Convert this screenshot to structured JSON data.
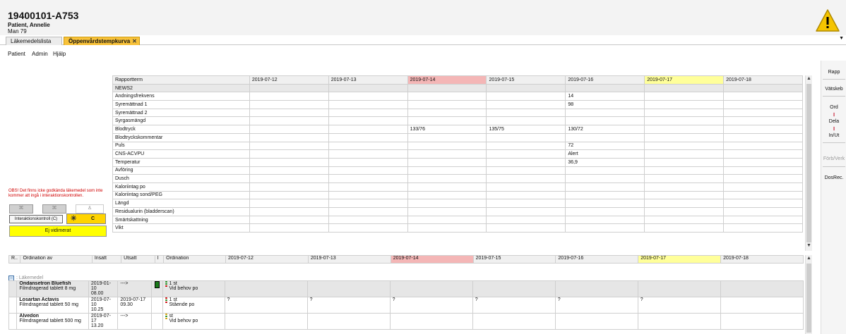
{
  "patient": {
    "id": "19400101-A753",
    "name": "Patient, Annelie",
    "gender_age": "Man 79"
  },
  "tabs": [
    {
      "label": "Läkemedelslista"
    },
    {
      "label": "Öppenvårdstempkurva"
    }
  ],
  "menu": [
    "Patient",
    "Admin",
    "Hjälp"
  ],
  "sidebar": [
    "Rapp",
    "Vätskeb",
    "Ord",
    "Dela",
    "In/Ut",
    "Förb/Verk",
    "DosRec."
  ],
  "left_panel": {
    "warning": "OBS! Det finns icke godkända läkemedel som inte kommer att ingå i interaktionskontrollen.",
    "interaction_button": "Interaktionskontroll (C)",
    "c_button": "C",
    "ejvid": "Ej vidimerat"
  },
  "vitals": {
    "header_term": "Rapportterm",
    "dates": [
      "2019-07-12",
      "2019-07-13",
      "2019-07-14",
      "2019-07-15",
      "2019-07-16",
      "2019-07-17",
      "2019-07-18"
    ],
    "highlight": {
      "2019-07-14": "#f4b6b6",
      "2019-07-17": "#ffff9a"
    },
    "rows": [
      {
        "term": "NEWS2",
        "values": [
          "",
          "",
          "",
          "",
          "",
          "",
          ""
        ]
      },
      {
        "term": "Andningsfrekvens",
        "values": [
          "",
          "",
          "",
          "",
          "14",
          "",
          ""
        ]
      },
      {
        "term": "Syremättnad 1",
        "values": [
          "",
          "",
          "",
          "",
          "98",
          "",
          ""
        ]
      },
      {
        "term": "Syremättnad 2",
        "values": [
          "",
          "",
          "",
          "",
          "",
          "",
          ""
        ]
      },
      {
        "term": "Syrgasmängd",
        "values": [
          "",
          "",
          "",
          "",
          "",
          "",
          ""
        ]
      },
      {
        "term": "Blodtryck",
        "values": [
          "",
          "",
          "133/76",
          "135/75",
          "130/72",
          "",
          ""
        ]
      },
      {
        "term": "Blodtryckskommentar",
        "values": [
          "",
          "",
          "",
          "",
          "",
          "",
          ""
        ]
      },
      {
        "term": "Puls",
        "values": [
          "",
          "",
          "",
          "",
          "72",
          "",
          ""
        ]
      },
      {
        "term": "CNS-ACVPU",
        "values": [
          "",
          "",
          "",
          "",
          "Alert",
          "",
          ""
        ]
      },
      {
        "term": "Temperatur",
        "values": [
          "",
          "",
          "",
          "",
          "36,9",
          "",
          ""
        ]
      },
      {
        "term": "Avföring",
        "values": [
          "",
          "",
          "",
          "",
          "",
          "",
          ""
        ]
      },
      {
        "term": "Dusch",
        "values": [
          "",
          "",
          "",
          "",
          "",
          "",
          ""
        ]
      },
      {
        "term": "Kaloriintag po",
        "values": [
          "",
          "",
          "",
          "",
          "",
          "",
          ""
        ]
      },
      {
        "term": "Kaloriintag sond/PEG",
        "values": [
          "",
          "",
          "",
          "",
          "",
          "",
          ""
        ]
      },
      {
        "term": "Längd",
        "values": [
          "",
          "",
          "",
          "",
          "",
          "",
          ""
        ]
      },
      {
        "term": "Residualurin (bladderscan)",
        "values": [
          "",
          "",
          "",
          "",
          "",
          "",
          ""
        ]
      },
      {
        "term": "Smärtskattning",
        "values": [
          "",
          "",
          "",
          "",
          "",
          "",
          ""
        ]
      },
      {
        "term": "Vikt",
        "values": [
          "",
          "",
          "",
          "",
          "",
          "",
          ""
        ]
      }
    ]
  },
  "orders": {
    "headers": {
      "r": "R..",
      "ordination_av": "Ordination av",
      "insatt": "Insatt",
      "utsatt": "Utsatt",
      "i": "I",
      "ordination": "Ordination"
    },
    "group_label": ": Läkemedel",
    "meds": [
      {
        "name": "Ondansetron Bluefish",
        "desc": "Filmdragerad tablett 8 mg",
        "insatt": "2019-01-10",
        "insatt_time": "08.00",
        "utsatt": "--->",
        "utsatt_time": "",
        "dose": "1 st",
        "instr": "Vid behov po",
        "light": "green",
        "marks": [
          "",
          "",
          "",
          "",
          "",
          "",
          ""
        ]
      },
      {
        "name": "Losartan Actavis",
        "desc": "Filmdragerad tablett 50 mg",
        "insatt": "2019-07-10",
        "insatt_time": "10.25",
        "utsatt": "2019-07-17",
        "utsatt_time": "09.30",
        "dose": "1 st",
        "instr": "Stående po",
        "light": "red",
        "marks": [
          "?",
          "?",
          "?",
          "?",
          "?",
          "?",
          ""
        ]
      },
      {
        "name": "Alvedon",
        "desc": "Filmdragerad tablett 500 mg",
        "insatt": "2019-07-17",
        "insatt_time": "13.20",
        "utsatt": "--->",
        "utsatt_time": "",
        "dose": "st",
        "instr": "Vid behov po",
        "light": "yellow",
        "marks": [
          "",
          "",
          "",
          "",
          "",
          "",
          ""
        ]
      }
    ]
  }
}
